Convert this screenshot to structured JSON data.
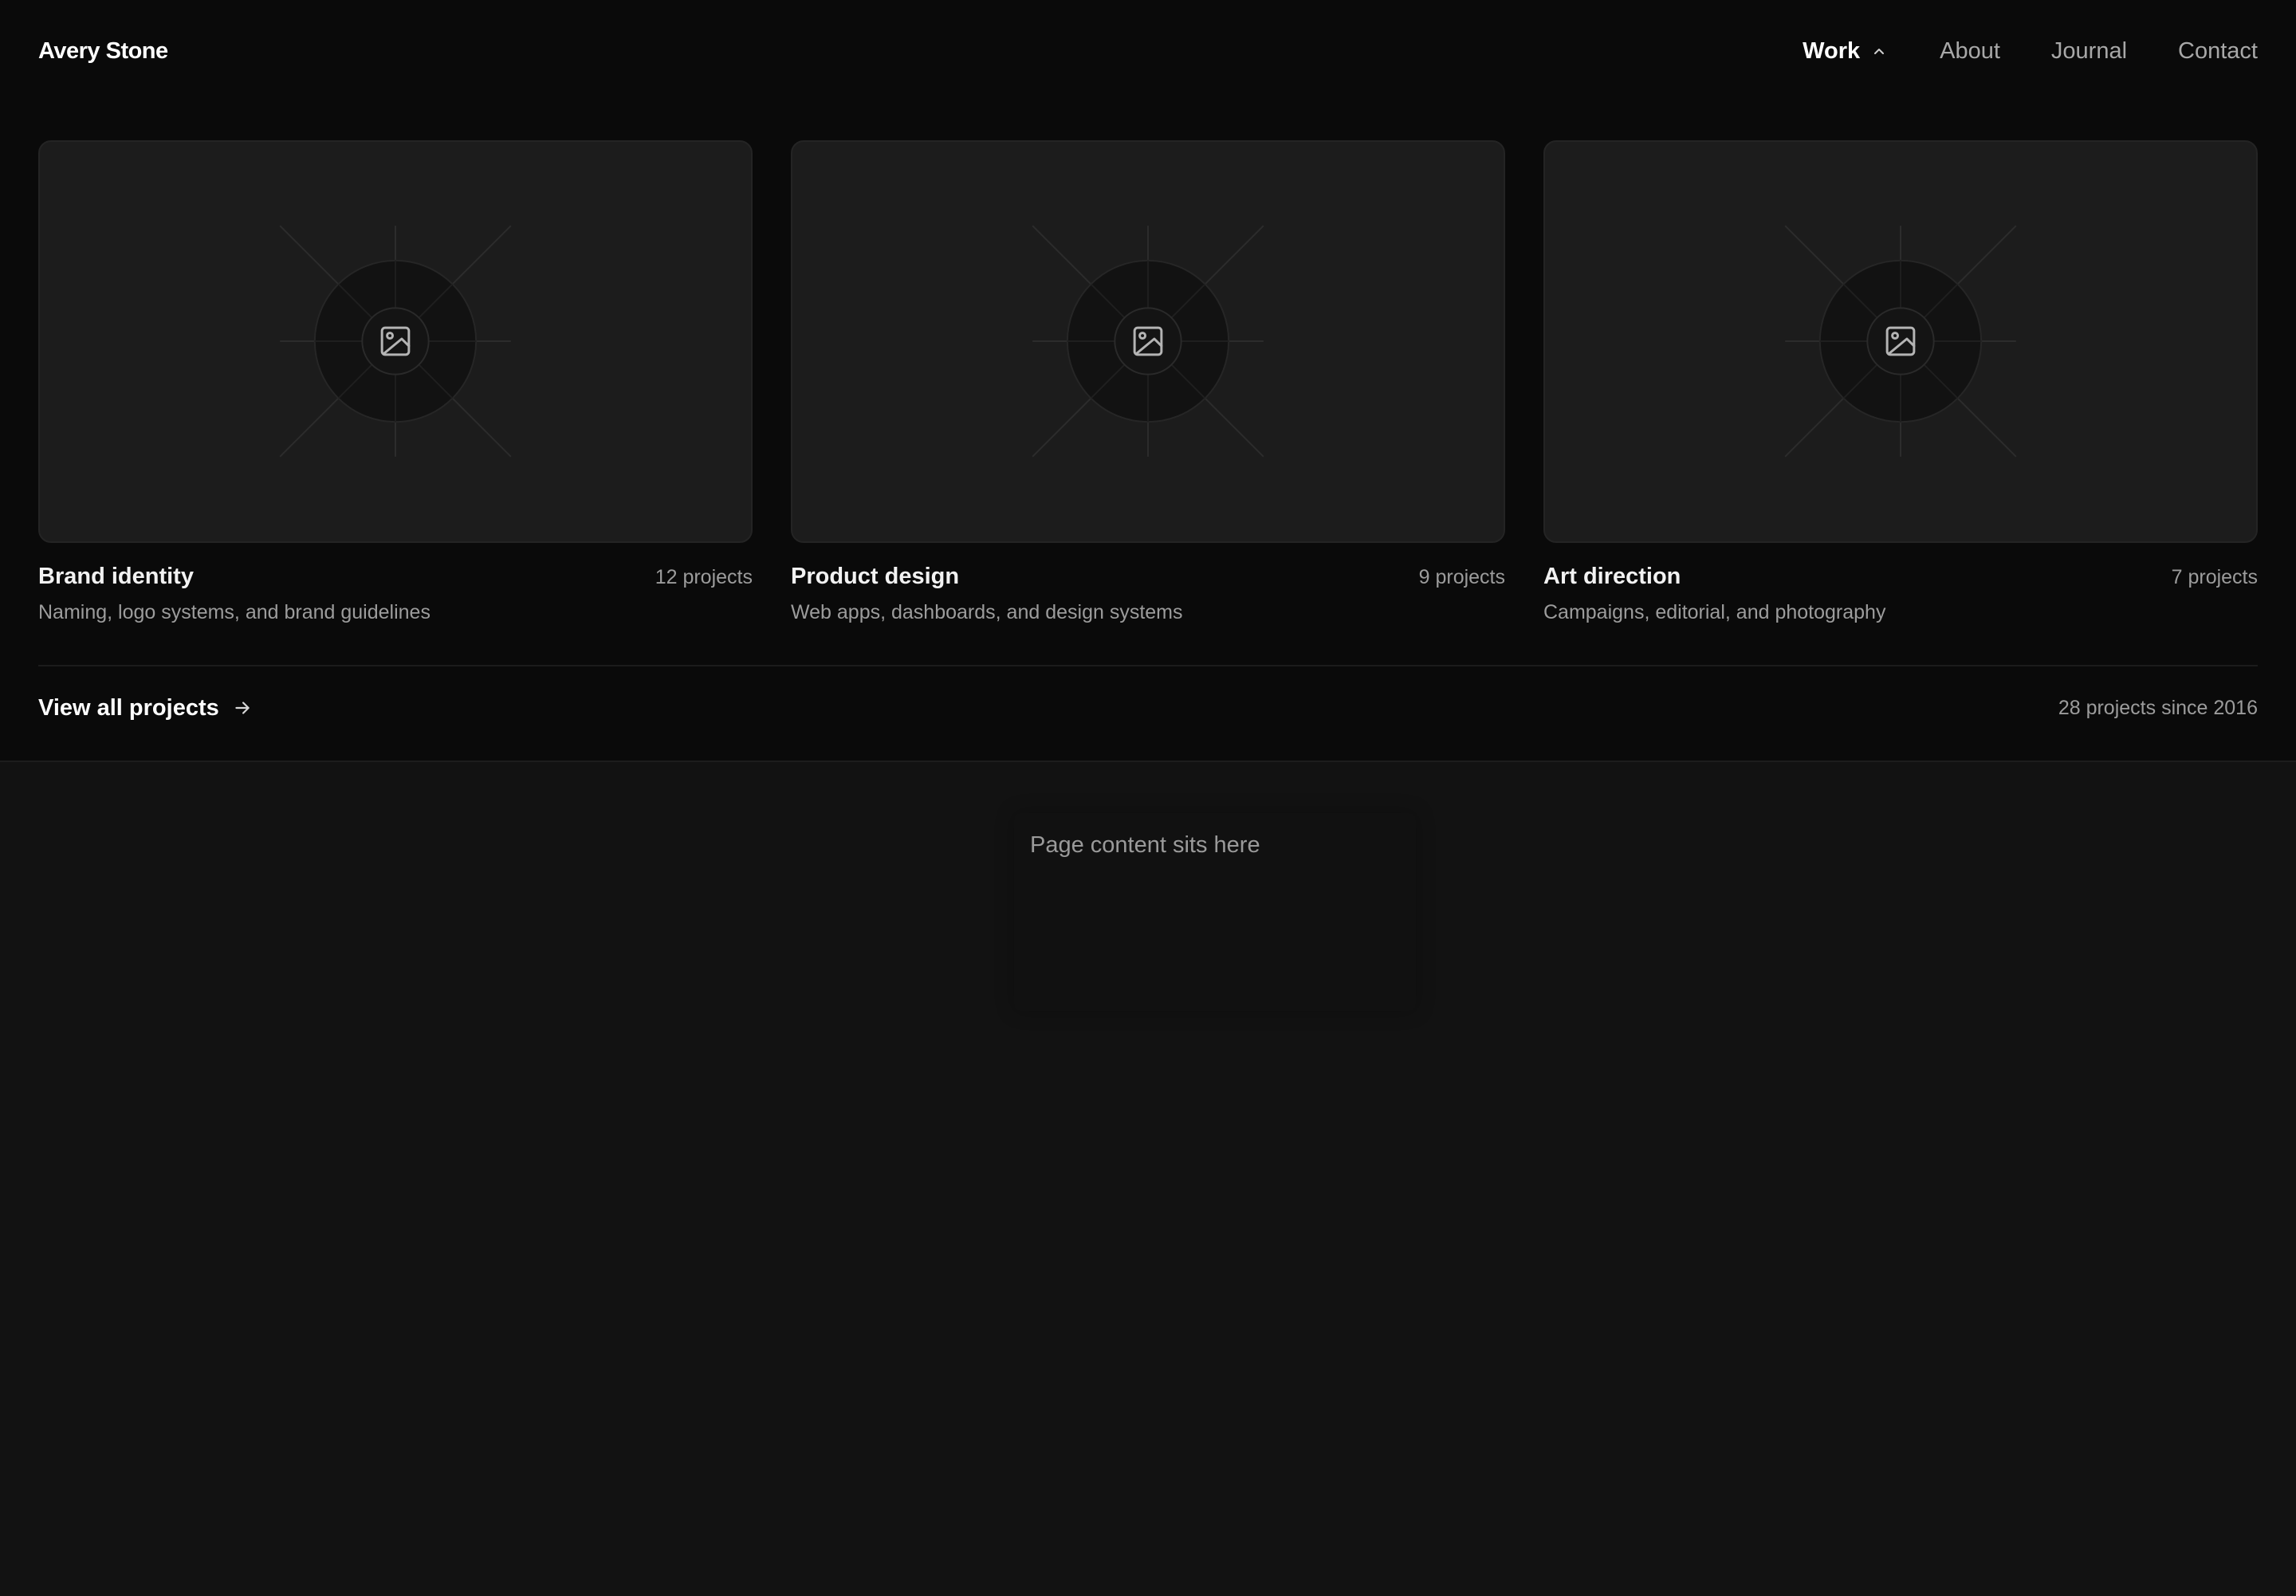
{
  "header": {
    "brand": "Avery Stone",
    "nav": [
      {
        "label": "Work",
        "active": true,
        "expanded": true
      },
      {
        "label": "About"
      },
      {
        "label": "Journal"
      },
      {
        "label": "Contact"
      }
    ]
  },
  "menu": {
    "cards": [
      {
        "title": "Brand identity",
        "count": "12 projects",
        "description": "Naming, logo systems, and brand guidelines",
        "icon": "image-placeholder-icon"
      },
      {
        "title": "Product design",
        "count": "9 projects",
        "description": "Web apps, dashboards, and design systems",
        "icon": "image-placeholder-icon"
      },
      {
        "title": "Art direction",
        "count": "7 projects",
        "description": "Campaigns, editorial, and photography",
        "icon": "image-placeholder-icon"
      }
    ],
    "view_all_label": "View all projects",
    "summary": "28 projects since 2016"
  },
  "page": {
    "placeholder": "Page content sits here"
  },
  "colors": {
    "background": "#121212",
    "panel": "#0a0a0a",
    "card": "#1c1c1c",
    "text_primary": "#ffffff",
    "text_muted": "#9c9c9c"
  }
}
